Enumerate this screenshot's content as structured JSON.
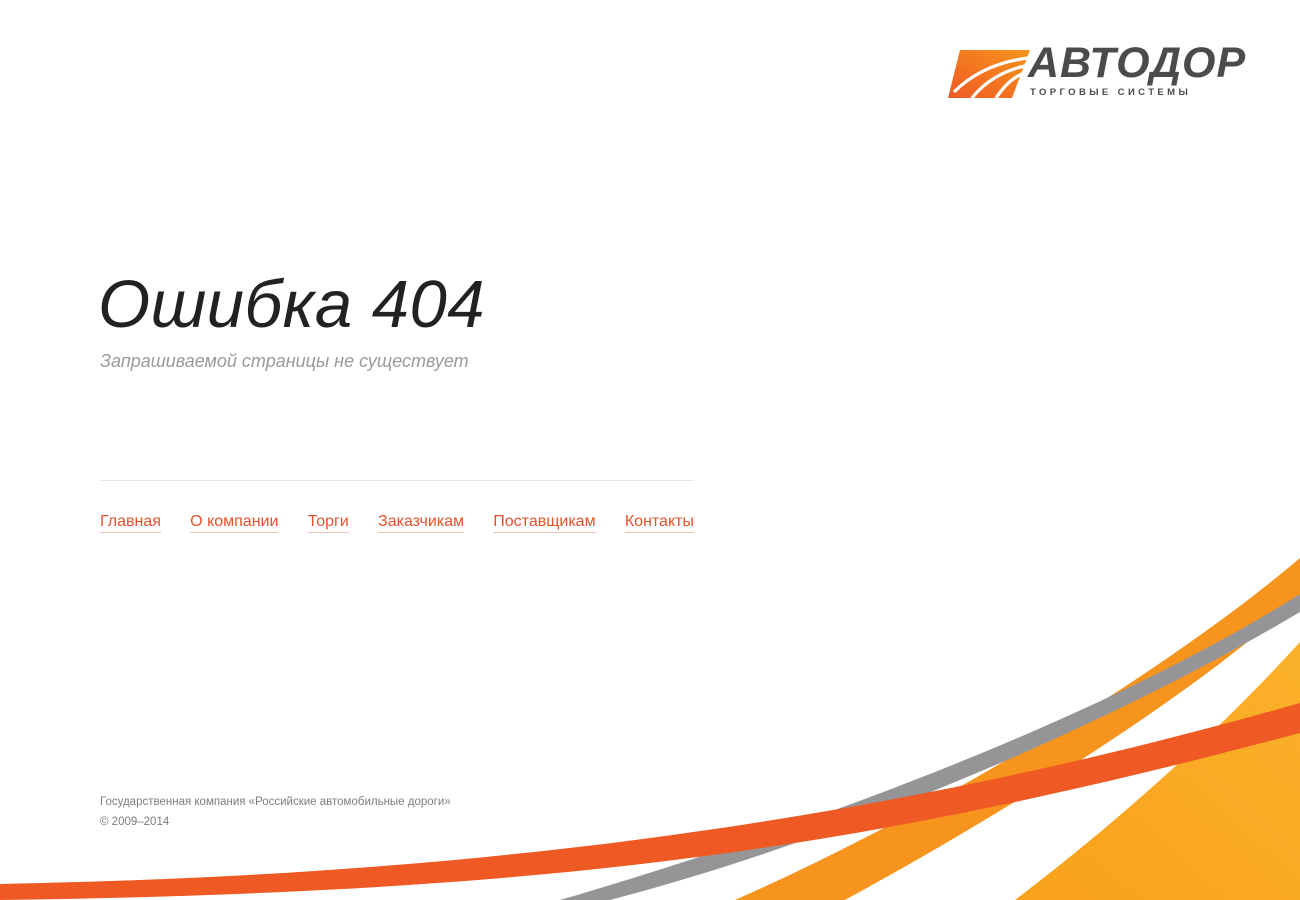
{
  "logo": {
    "wordmark": "АВТОДОР",
    "subtitle": "ТОРГОВЫЕ СИСТЕМЫ",
    "colors": {
      "orange": "#f7941d",
      "red": "#ef5a24",
      "text": "#4b4a4c"
    }
  },
  "error": {
    "title": "Ошибка 404",
    "subtitle": "Запрашиваемой страницы не существует"
  },
  "nav": {
    "items": [
      {
        "label": "Главная"
      },
      {
        "label": "О компании"
      },
      {
        "label": "Торги"
      },
      {
        "label": "Заказчикам"
      },
      {
        "label": "Поставщикам"
      },
      {
        "label": "Контакты"
      }
    ]
  },
  "footer": {
    "company": "Государственная компания «Российские автомобильные дороги»",
    "copyright": "© 2009–2014"
  },
  "colors": {
    "link": "#e5522b",
    "swoosh_orange": "#f7941d",
    "swoosh_yellow": "#f9a520",
    "swoosh_red": "#ef5a24",
    "swoosh_gray": "#959597"
  }
}
